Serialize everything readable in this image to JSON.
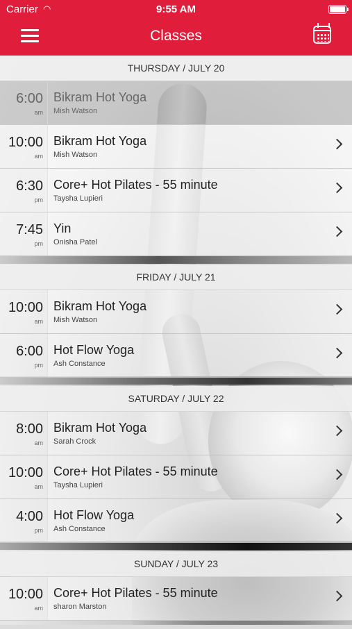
{
  "status": {
    "carrier": "Carrier",
    "time": "9:55 AM"
  },
  "nav": {
    "title": "Classes"
  },
  "days": [
    {
      "header": "THURSDAY / JULY 20",
      "classes": [
        {
          "time": "6:00",
          "ampm": "am",
          "name": "Bikram Hot Yoga",
          "instructor": "Mish Watson",
          "past": true
        },
        {
          "time": "10:00",
          "ampm": "am",
          "name": "Bikram Hot Yoga",
          "instructor": "Mish Watson"
        },
        {
          "time": "6:30",
          "ampm": "pm",
          "name": "Core+ Hot Pilates - 55 minute",
          "instructor": "Taysha Lupieri"
        },
        {
          "time": "7:45",
          "ampm": "pm",
          "name": "Yin",
          "instructor": "Onisha Patel"
        }
      ]
    },
    {
      "header": "FRIDAY / JULY 21",
      "classes": [
        {
          "time": "10:00",
          "ampm": "am",
          "name": "Bikram Hot Yoga",
          "instructor": "Mish Watson"
        },
        {
          "time": "6:00",
          "ampm": "pm",
          "name": "Hot Flow Yoga",
          "instructor": "Ash Constance"
        }
      ]
    },
    {
      "header": "SATURDAY / JULY 22",
      "classes": [
        {
          "time": "8:00",
          "ampm": "am",
          "name": "Bikram Hot Yoga",
          "instructor": "Sarah Crock"
        },
        {
          "time": "10:00",
          "ampm": "am",
          "name": "Core+ Hot Pilates - 55 minute",
          "instructor": "Taysha Lupieri"
        },
        {
          "time": "4:00",
          "ampm": "pm",
          "name": "Hot Flow Yoga",
          "instructor": "Ash Constance"
        }
      ]
    },
    {
      "header": "SUNDAY / JULY 23",
      "classes": [
        {
          "time": "10:00",
          "ampm": "am",
          "name": "Core+ Hot Pilates - 55 minute",
          "instructor": "sharon Marston"
        }
      ]
    }
  ]
}
